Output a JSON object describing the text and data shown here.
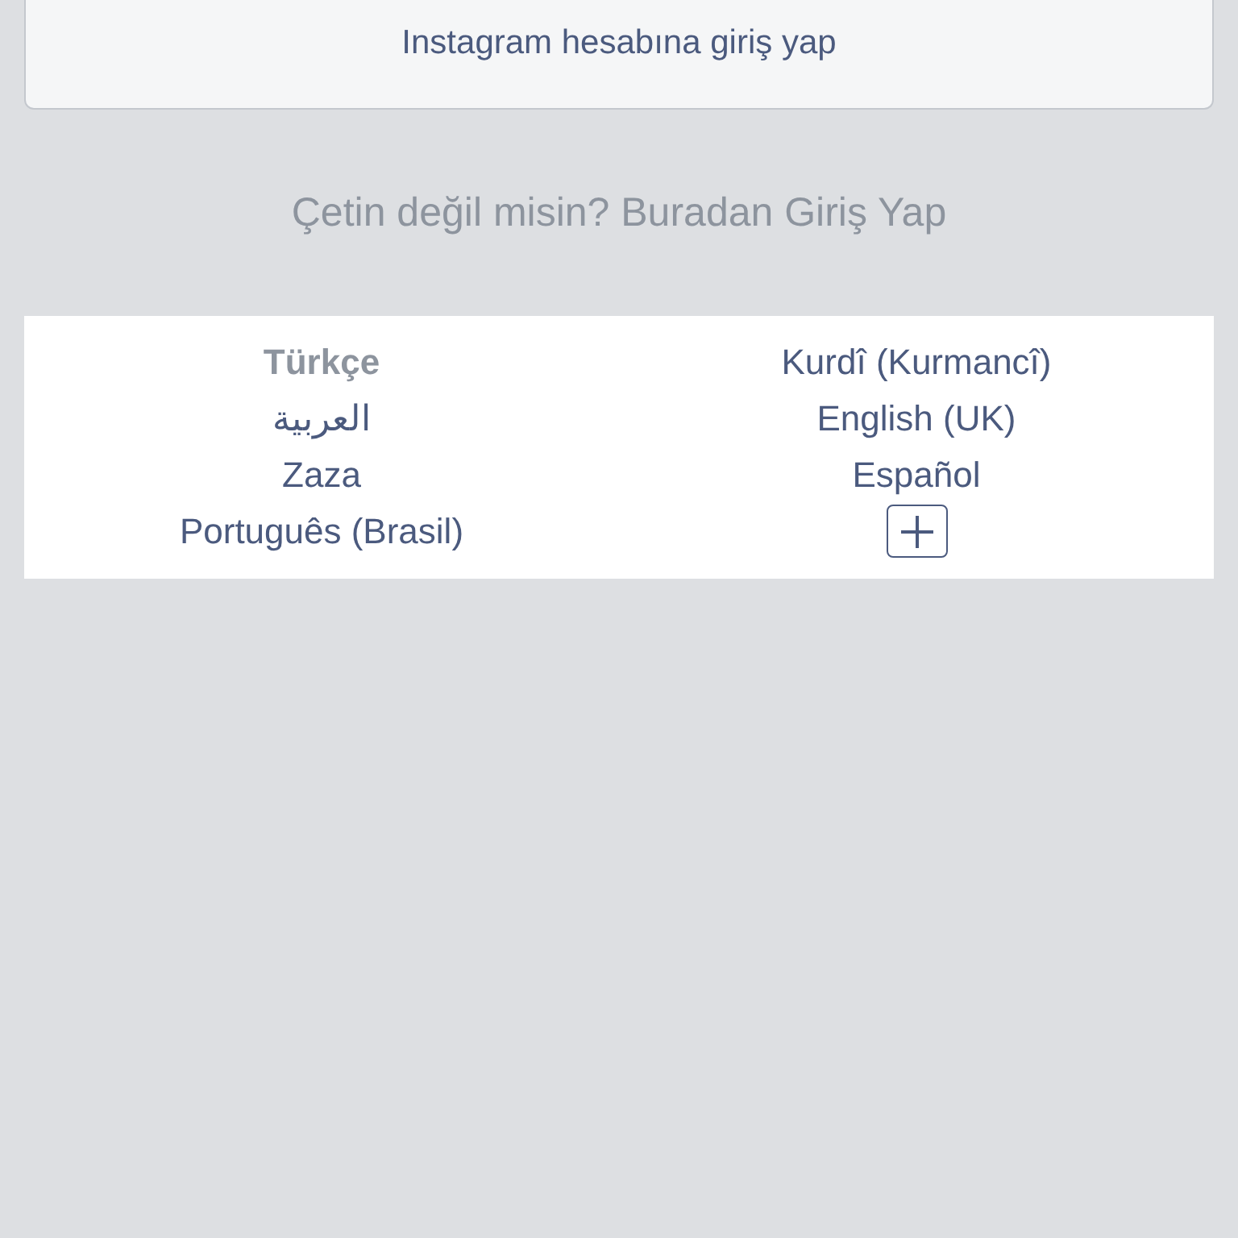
{
  "account_card": {
    "label": "Instagram hesabına giriş yap"
  },
  "switch_account": {
    "label": "Çetin değil misin? Buradan Giriş Yap"
  },
  "languages": [
    {
      "label": "Türkçe",
      "selected": true
    },
    {
      "label": "Kurdî (Kurmancî)",
      "selected": false
    },
    {
      "label": "العربية",
      "selected": false
    },
    {
      "label": "English (UK)",
      "selected": false
    },
    {
      "label": "Zaza",
      "selected": false
    },
    {
      "label": "Español",
      "selected": false
    },
    {
      "label": "Português (Brasil)",
      "selected": false
    }
  ]
}
